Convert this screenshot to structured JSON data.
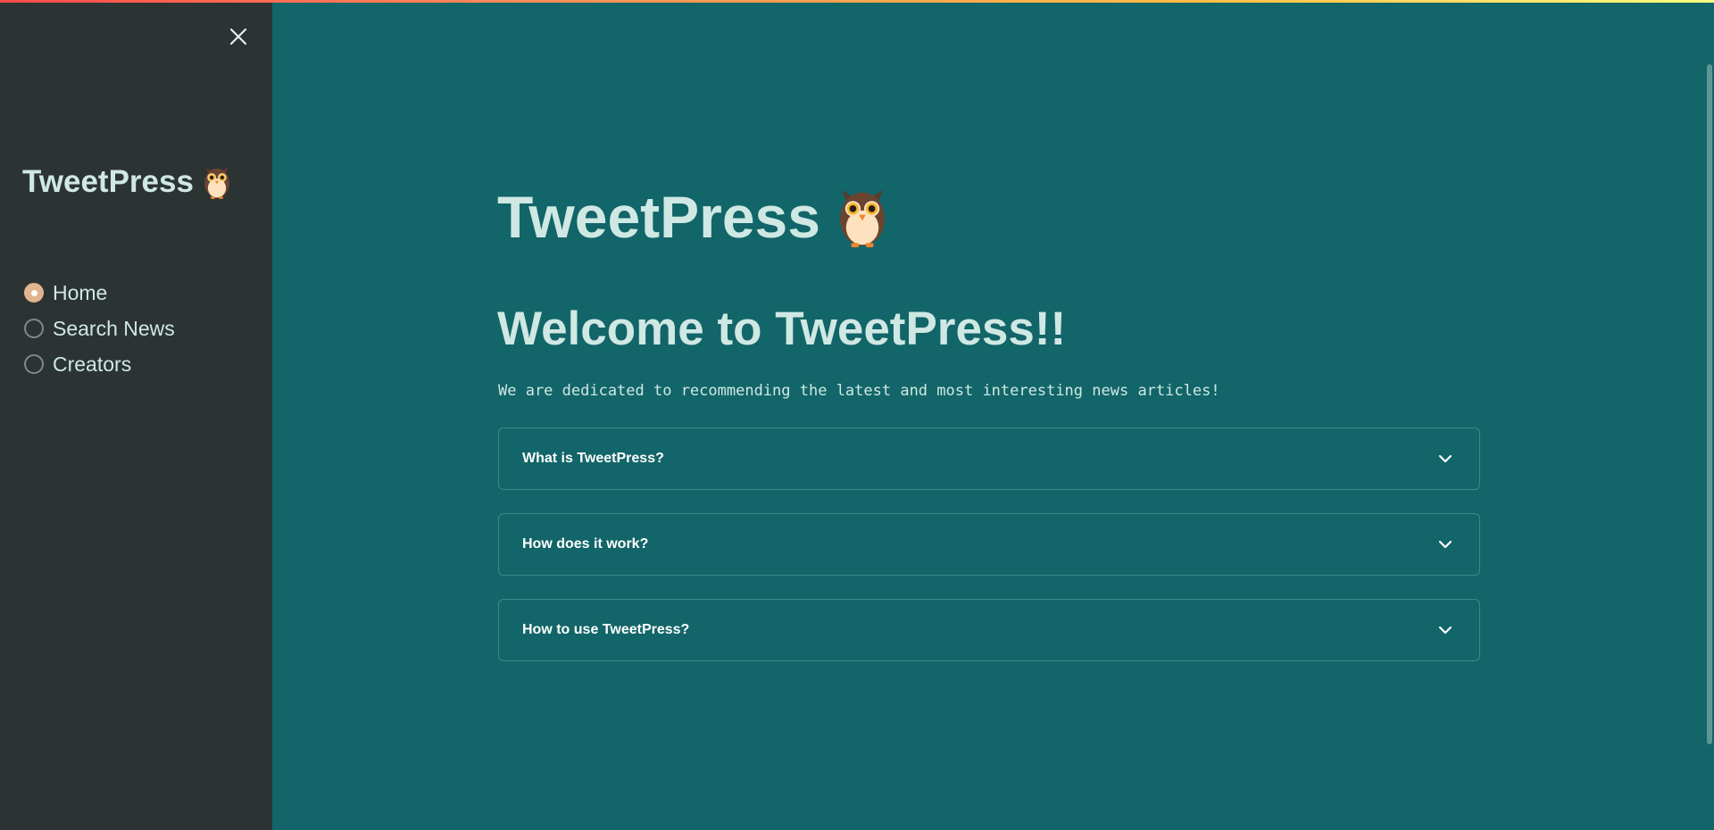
{
  "app": {
    "name": "TweetPress",
    "logo_icon": "owl-emoji",
    "top_bar_gradient": [
      "#ff4b4b",
      "#ffbd45",
      "#fffd80"
    ]
  },
  "sidebar": {
    "title": "TweetPress",
    "close_icon": "close-icon",
    "nav": {
      "selected": "Home",
      "options": [
        {
          "label": "Home",
          "checked": true
        },
        {
          "label": "Search News",
          "checked": false
        },
        {
          "label": "Creators",
          "checked": false
        }
      ]
    }
  },
  "main": {
    "title": "TweetPress",
    "welcome": "Welcome to TweetPress!!",
    "tagline": "We are dedicated to recommending the latest and most interesting news articles!",
    "expanders": [
      {
        "label": "What is TweetPress?",
        "icon": "chevron-down-icon"
      },
      {
        "label": "How does it work?",
        "icon": "chevron-down-icon"
      },
      {
        "label": "How to use TweetPress?",
        "icon": "chevron-down-icon"
      }
    ]
  },
  "colors": {
    "main_background": "#126568",
    "sidebar_background": "#2c3433",
    "text": "#cfe8e4",
    "radio_accent": "#e2b490"
  }
}
